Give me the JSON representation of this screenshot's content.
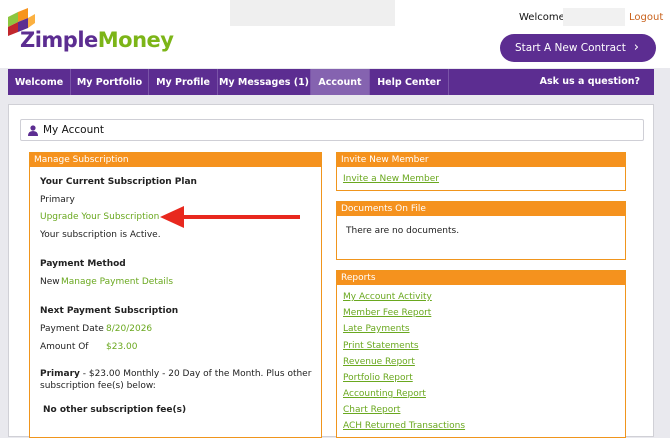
{
  "header": {
    "brand_part1": "Zimple",
    "brand_part2": "Money",
    "welcome": "Welcome,",
    "logout": "Logout",
    "start_contract": "Start A New Contract",
    "start_chevron": "›"
  },
  "nav": {
    "items": [
      {
        "label": "Welcome"
      },
      {
        "label": "My Portfolio"
      },
      {
        "label": "My Profile"
      },
      {
        "label": "My Messages (1)"
      },
      {
        "label": "Account"
      },
      {
        "label": "Help Center"
      }
    ],
    "ask": "Ask us a question?"
  },
  "page": {
    "title": "My Account"
  },
  "subscription": {
    "header": "Manage Subscription",
    "current_plan_heading": "Your Current Subscription Plan",
    "plan_name": "Primary",
    "upgrade_link": "Upgrade Your Subscription",
    "status": "Your subscription is Active.",
    "payment_method_heading": "Payment Method",
    "payment_method_value": "New",
    "manage_payment_link": "Manage Payment Details",
    "next_payment_heading": "Next Payment Subscription",
    "payment_date_label": "Payment Date",
    "payment_date_value": "8/20/2026",
    "amount_label": "Amount Of",
    "amount_value": "$23.00",
    "fee_line_bold": "Primary",
    "fee_line_1": " - $23.00 Monthly - 20 Day of the Month. Plus other",
    "fee_line_2": "subscription fee(s) below:",
    "no_other_fees": "No other subscription fee(s)"
  },
  "invite": {
    "header": "Invite New Member",
    "link": "Invite a New Member"
  },
  "documents": {
    "header": "Documents On File",
    "empty": "There are no documents."
  },
  "reports": {
    "header": "Reports",
    "links": [
      "My Account Activity",
      "Member Fee Report",
      "Late Payments",
      "Print Statements",
      "Revenue Report",
      "Portfolio Report",
      "Accounting Report",
      "Chart Report",
      "ACH Returned Transactions"
    ]
  },
  "colors": {
    "brand_purple": "#5c2d91",
    "brand_green": "#7cb518",
    "panel_orange": "#f5921e",
    "link_green": "#6aa81f",
    "annotation_red": "#e8281e"
  }
}
